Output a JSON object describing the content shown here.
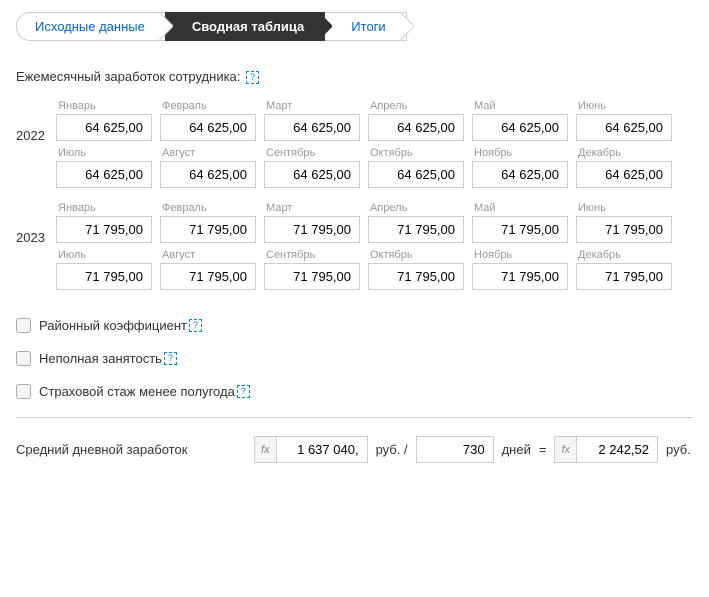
{
  "tabs": {
    "source": "Исходные данные",
    "summary": "Сводная таблица",
    "results": "Итоги"
  },
  "section_title": "Ежемесячный заработок сотрудника:",
  "months": {
    "jan": "Январь",
    "feb": "Февраль",
    "mar": "Март",
    "apr": "Апрель",
    "may": "Май",
    "jun": "Июнь",
    "jul": "Июль",
    "aug": "Август",
    "sep": "Сентябрь",
    "oct": "Октябрь",
    "nov": "Ноябрь",
    "dec": "Декабрь"
  },
  "years": {
    "y2022": {
      "label": "2022",
      "values": {
        "jan": "64 625,00",
        "feb": "64 625,00",
        "mar": "64 625,00",
        "apr": "64 625,00",
        "may": "64 625,00",
        "jun": "64 625,00",
        "jul": "64 625,00",
        "aug": "64 625,00",
        "sep": "64 625,00",
        "oct": "64 625,00",
        "nov": "64 625,00",
        "dec": "64 625,00"
      }
    },
    "y2023": {
      "label": "2023",
      "values": {
        "jan": "71 795,00",
        "feb": "71 795,00",
        "mar": "71 795,00",
        "apr": "71 795,00",
        "may": "71 795,00",
        "jun": "71 795,00",
        "jul": "71 795,00",
        "aug": "71 795,00",
        "sep": "71 795,00",
        "oct": "71 795,00",
        "nov": "71 795,00",
        "dec": "71 795,00"
      }
    }
  },
  "checkboxes": {
    "regional": "Районный коэффициент",
    "parttime": "Неполная занятость",
    "insurance": "Страховой стаж менее полугода"
  },
  "result": {
    "label": "Средний дневной заработок",
    "total": "1 637 040,",
    "unit1": "руб. /",
    "days": "730",
    "unit2": "дней",
    "equals": "=",
    "average": "2 242,52",
    "unit3": "руб."
  },
  "fx": "fx",
  "help": "?"
}
